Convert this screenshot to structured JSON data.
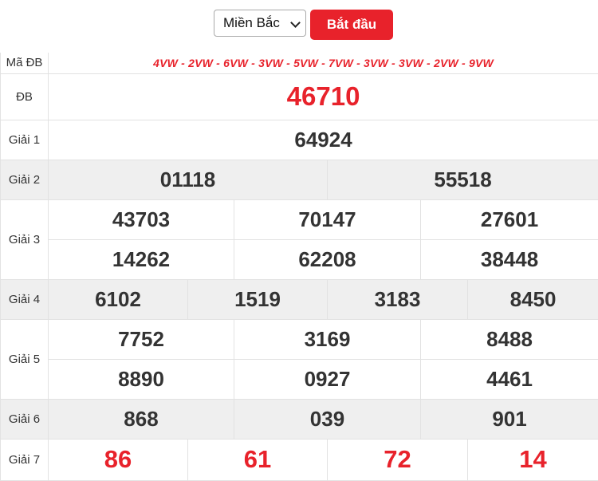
{
  "controls": {
    "region_selected": "Miền Bắc",
    "start_label": "Bắt đầu"
  },
  "table": {
    "ma_db": {
      "label": "Mã ĐB",
      "codes": "4VW - 2VW - 6VW - 3VW - 5VW - 7VW - 3VW - 3VW - 2VW - 9VW"
    },
    "db": {
      "label": "ĐB",
      "value": "46710"
    },
    "giai1": {
      "label": "Giải 1",
      "values": [
        "64924"
      ]
    },
    "giai2": {
      "label": "Giải 2",
      "values": [
        "01118",
        "55518"
      ]
    },
    "giai3": {
      "label": "Giải 3",
      "values": [
        "43703",
        "70147",
        "27601",
        "14262",
        "62208",
        "38448"
      ]
    },
    "giai4": {
      "label": "Giải 4",
      "values": [
        "6102",
        "1519",
        "3183",
        "8450"
      ]
    },
    "giai5": {
      "label": "Giải 5",
      "values": [
        "7752",
        "3169",
        "8488",
        "8890",
        "0927",
        "4461"
      ]
    },
    "giai6": {
      "label": "Giải 6",
      "values": [
        "868",
        "039",
        "901"
      ]
    },
    "giai7": {
      "label": "Giải 7",
      "values": [
        "86",
        "61",
        "72",
        "14"
      ]
    }
  },
  "colors": {
    "accent_red": "#e8222b",
    "row_shade": "#efefef",
    "border": "#e2e2e2"
  }
}
